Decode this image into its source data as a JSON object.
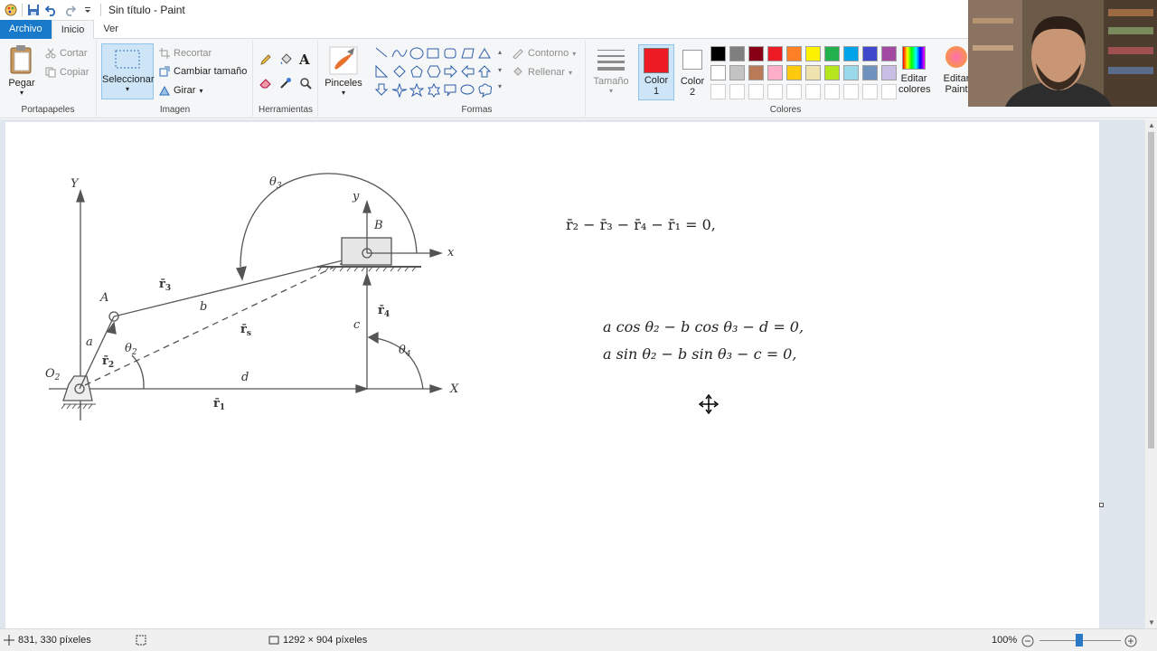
{
  "window": {
    "title": "Sin título - Paint"
  },
  "tabs": [
    {
      "label": "Archivo"
    },
    {
      "label": "Inicio"
    },
    {
      "label": "Ver"
    }
  ],
  "clipboard": {
    "paste": "Pegar",
    "cut": "Cortar",
    "copy": "Copiar",
    "group": "Portapapeles"
  },
  "image": {
    "select": "Seleccionar",
    "crop": "Recortar",
    "resize": "Cambiar tamaño",
    "rotate": "Girar",
    "group": "Imagen"
  },
  "tools": {
    "group": "Herramientas"
  },
  "brushes": {
    "label": "Pinceles"
  },
  "shapes": {
    "outline": "Contorno",
    "fill": "Rellenar",
    "group": "Formas"
  },
  "size": {
    "label": "Tamaño"
  },
  "colors": {
    "color1_l1": "Color",
    "color1_l2": "1",
    "color2_l1": "Color",
    "color2_l2": "2",
    "edit_l1": "Editar",
    "edit_l2": "colores",
    "paint3d_l1": "Editar",
    "paint3d_l2": "Paint",
    "group": "Colores",
    "color1_value": "#ed1c24",
    "color2_value": "#ffffff",
    "palette_row1": [
      "#000000",
      "#7f7f7f",
      "#880015",
      "#ed1c24",
      "#ff7f27",
      "#fff200",
      "#22b14c",
      "#00a2e8",
      "#3f48cc",
      "#a349a4"
    ],
    "palette_row2": [
      "#ffffff",
      "#c3c3c3",
      "#b97a57",
      "#ffaec9",
      "#ffc90e",
      "#efe4b0",
      "#b5e61d",
      "#99d9ea",
      "#7092be",
      "#c8bfe7"
    ]
  },
  "drawing": {
    "labels": {
      "Y": "Y",
      "theta3": "θ",
      "theta3_sub": "3",
      "y": "y",
      "B": "B",
      "x": "x",
      "r3": "r̄",
      "r3_sub": "3",
      "A": "A",
      "b": "b",
      "rs": "r̄",
      "rs_sub": "s",
      "c": "c",
      "r4": "r̄",
      "r4_sub": "4",
      "a": "a",
      "theta2": "θ",
      "theta2_sub": "2",
      "r2": "r̄",
      "r2_sub": "2",
      "O2": "O",
      "O2_sub": "2",
      "d": "d",
      "theta4": "θ",
      "theta4_sub": "4",
      "X": "X",
      "r1": "r̄",
      "r1_sub": "1"
    },
    "eq1": "r̄₂ − r̄₃ − r̄₄ − r̄₁ = 0,",
    "eq2": "a cos θ₂ − b cos θ₃ − d = 0,",
    "eq3": "a sin θ₂ − b sin θ₃ − c = 0,"
  },
  "status": {
    "cursor": "831, 330 píxeles",
    "dimensions": "1292 × 904 píxeles",
    "zoom": "100%"
  },
  "icons": [
    "save-icon",
    "undo-icon",
    "redo-icon",
    "pencil-icon",
    "fill-icon",
    "text-icon",
    "eraser-icon",
    "color-picker-icon",
    "magnifier-icon",
    "zoom-out-icon",
    "zoom-in-icon"
  ]
}
